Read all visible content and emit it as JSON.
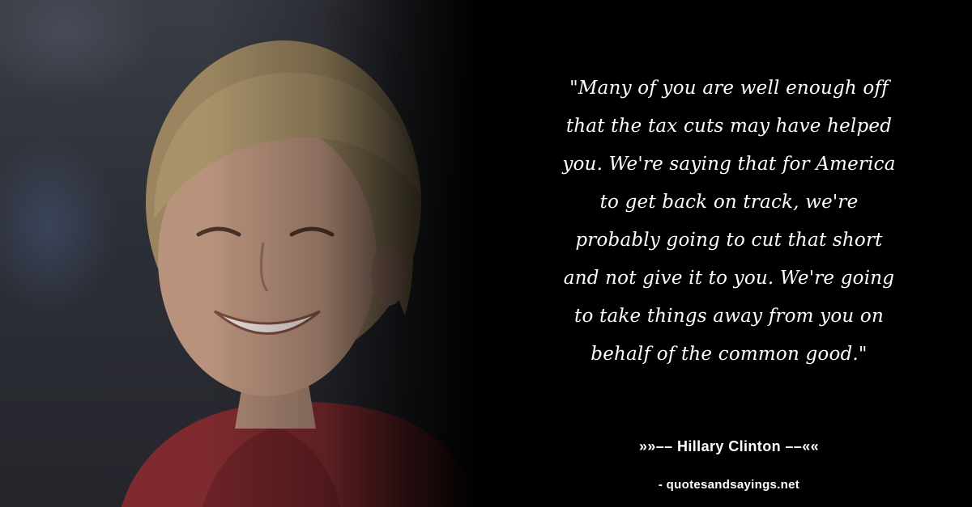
{
  "quote": {
    "lines": [
      "\"Many of you are well enough off",
      "that the tax cuts may have helped",
      "you. We're saying that for America",
      "to get back on track, we're",
      "probably going to cut that short",
      "and not give it to you. We're going",
      "to take things away from you on",
      "behalf of the common good.\""
    ]
  },
  "author": {
    "text": "»»–– Hillary Clinton ––««"
  },
  "source": {
    "text": "- quotesandsayings.net"
  },
  "colors": {
    "background": "#000000",
    "text": "#ffffff",
    "jacket": "#8a2a2f"
  }
}
